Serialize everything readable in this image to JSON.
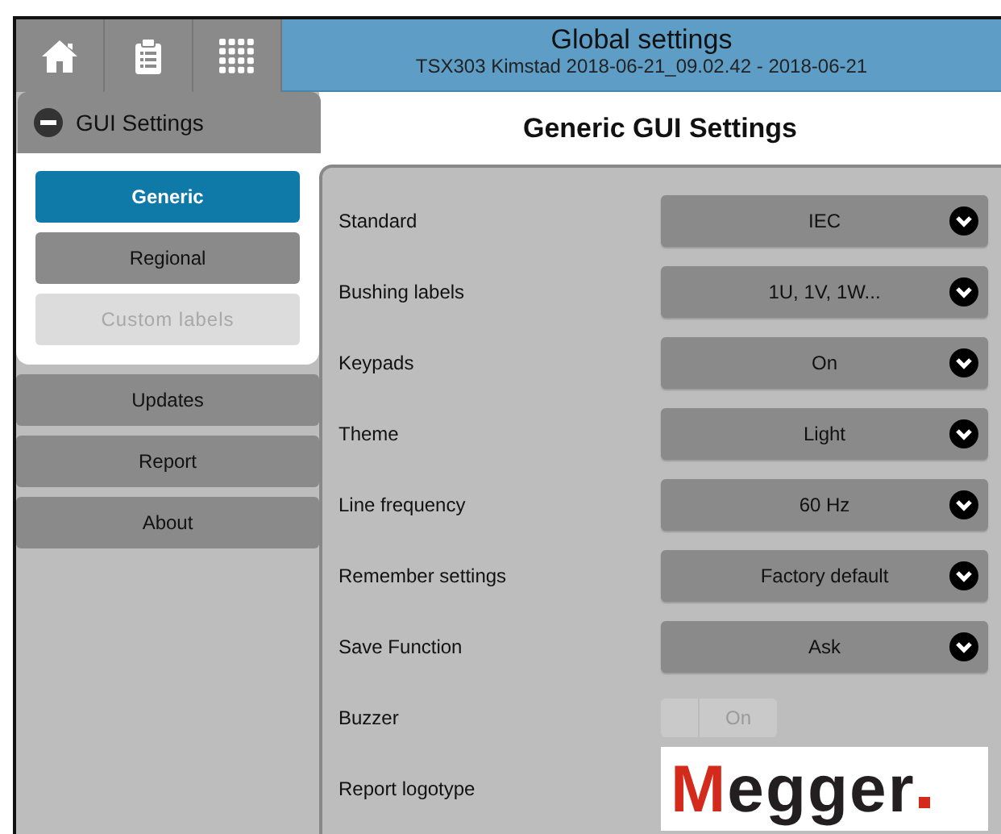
{
  "header": {
    "title": "Global settings",
    "subtitle": "TSX303 Kimstad 2018-06-21_09.02.42 - 2018-06-21"
  },
  "sidebar": {
    "group": {
      "title": "GUI Settings",
      "expanded": true,
      "items": [
        {
          "label": "Generic",
          "selected": true,
          "disabled": false
        },
        {
          "label": "Regional",
          "selected": false,
          "disabled": false
        },
        {
          "label": "Custom labels",
          "selected": false,
          "disabled": true
        }
      ]
    },
    "items": [
      {
        "label": "Updates"
      },
      {
        "label": "Report"
      },
      {
        "label": "About"
      }
    ]
  },
  "content": {
    "title": "Generic GUI Settings",
    "settings": [
      {
        "label": "Standard",
        "kind": "dropdown",
        "value": "IEC"
      },
      {
        "label": "Bushing labels",
        "kind": "dropdown",
        "value": "1U, 1V, 1W..."
      },
      {
        "label": "Keypads",
        "kind": "dropdown",
        "value": "On"
      },
      {
        "label": "Theme",
        "kind": "dropdown",
        "value": "Light"
      },
      {
        "label": "Line frequency",
        "kind": "dropdown",
        "value": "60 Hz"
      },
      {
        "label": "Remember settings",
        "kind": "dropdown",
        "value": "Factory default"
      },
      {
        "label": "Save Function",
        "kind": "dropdown",
        "value": "Ask"
      },
      {
        "label": "Buzzer",
        "kind": "toggle",
        "value": "On",
        "disabled": true
      },
      {
        "label": "Report logotype",
        "kind": "logo",
        "value": "Megger"
      }
    ]
  }
}
